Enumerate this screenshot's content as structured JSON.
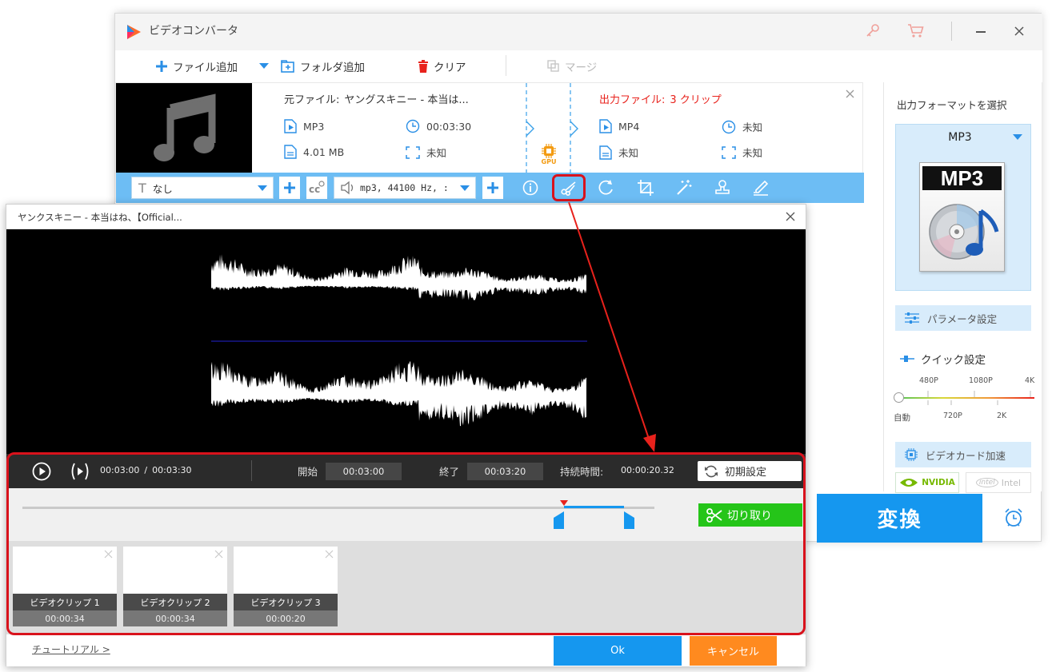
{
  "main": {
    "title": "ビデオコンバータ",
    "toolbar": {
      "add_file": "ファイル追加",
      "add_folder": "フォルダ追加",
      "clear": "クリア",
      "merge": "マージ"
    },
    "source": {
      "label": "元ファイル:",
      "name": "ヤングスキニー - 本当は...",
      "format": "MP3",
      "duration": "00:03:30",
      "size": "4.01 MB",
      "resolution": "未知"
    },
    "gpu_label": "GPU",
    "output": {
      "label": "出力ファイル:",
      "count": "3 クリップ",
      "format": "MP4",
      "duration": "未知",
      "size": "未知",
      "resolution": "未知"
    },
    "edit_bar": {
      "subtitle_value": "なし",
      "audio_value": "mp3, 44100 Hz, :"
    }
  },
  "sidebar": {
    "format_header": "出力フォーマットを選択",
    "format_name": "MP3",
    "format_icon_text": "MP3",
    "param_settings": "パラメータ設定",
    "quick_settings": "クイック設定",
    "quality_top": [
      "480P",
      "1080P",
      "4K"
    ],
    "quality_bottom": [
      "自動",
      "720P",
      "2K"
    ],
    "quality_level": 0,
    "gpu_accel": "ビデオカード加速",
    "nvidia": "NVIDIA",
    "intel": "Intel"
  },
  "convert_label": "変換",
  "dialog": {
    "title": "ヤンクスキニー - 本当はね、【Official...",
    "current_time": "00:03:00",
    "separator": "/",
    "total_time": "00:03:30",
    "start_label": "開始",
    "start_value": "00:03:00",
    "end_label": "終了",
    "end_value": "00:03:20",
    "duration_label": "持続時間:",
    "duration_value": "00:00:20.32",
    "reset_label": "初期設定",
    "cut_label": "切り取り",
    "trim": {
      "playhead": 0.857,
      "start": 0.857,
      "end": 0.952
    },
    "clips": [
      {
        "label": "ビデオクリップ 1",
        "duration": "00:00:34"
      },
      {
        "label": "ビデオクリップ 2",
        "duration": "00:00:34"
      },
      {
        "label": "ビデオクリップ 3",
        "duration": "00:00:20"
      }
    ],
    "tutorial": "チュートリアル >",
    "ok": "Ok",
    "cancel": "キャンセル"
  },
  "colors": {
    "accent_blue": "#1597ef",
    "edit_bar_blue": "#6dbdf4",
    "highlight_red": "#d9121c",
    "cut_green": "#25c519",
    "cancel_orange": "#ff8a1f"
  }
}
